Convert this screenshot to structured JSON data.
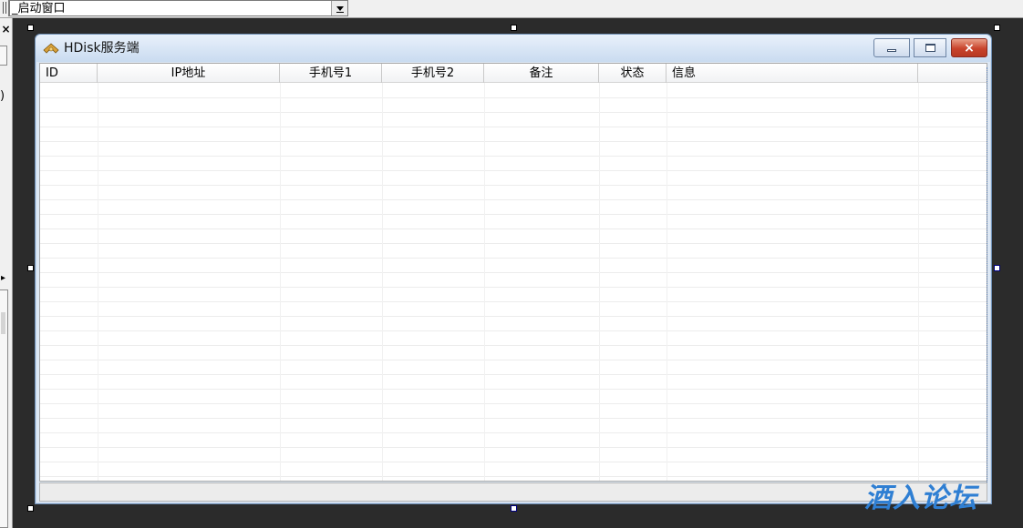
{
  "toolbar": {
    "combo_value": "_启动窗口"
  },
  "left_panel": {
    "close_glyph": "×",
    "paren_glyph": ")"
  },
  "window": {
    "title": "HDisk服务端",
    "close_glyph": "×"
  },
  "grid": {
    "columns": [
      {
        "label": "ID"
      },
      {
        "label": "IP地址"
      },
      {
        "label": "手机号1"
      },
      {
        "label": "手机号2"
      },
      {
        "label": "备注"
      },
      {
        "label": "状态"
      },
      {
        "label": "信息"
      },
      {
        "label": ""
      }
    ],
    "rows": []
  },
  "statusbar": {
    "text": ""
  },
  "watermark": {
    "text": "酒入论坛"
  },
  "colors": {
    "desktop": "#2b2b2b",
    "titlebar_top": "#e9f1fb",
    "titlebar_bottom": "#c9dbf0",
    "close_button": "#c8432b",
    "watermark": "#2f7fd3"
  }
}
